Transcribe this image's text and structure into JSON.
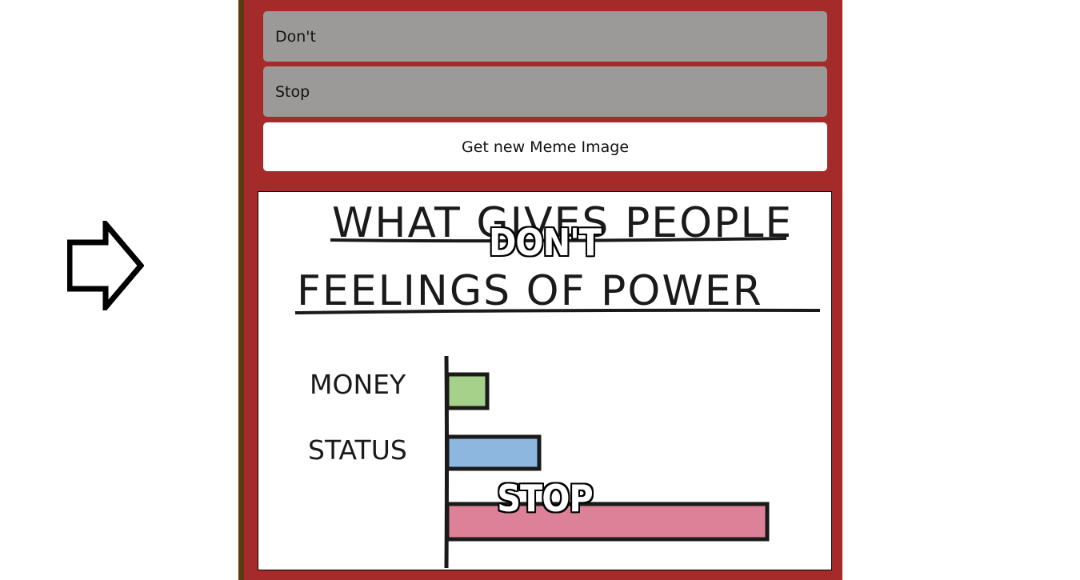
{
  "inputs": {
    "top_text": "Don't",
    "bottom_text": "Stop"
  },
  "button": {
    "label": "Get new Meme Image"
  },
  "meme": {
    "top_caption": "Don't",
    "bottom_caption": "Stop",
    "image": {
      "title_line1": "WHAT GIVES PEOPLE",
      "title_line2": "FEELINGS OF POWER",
      "bar_labels": [
        "MONEY",
        "STATUS"
      ],
      "bar_values": [
        1,
        2.3,
        8
      ],
      "bar_colors": [
        "#a6d18a",
        "#8db7de",
        "#dc8198"
      ]
    }
  },
  "colors": {
    "panel": "#a52a2a",
    "panel_border": "#5e3a12",
    "field": "#9c9a98"
  },
  "icons": {
    "arrow": "right-arrow-outline-icon"
  }
}
